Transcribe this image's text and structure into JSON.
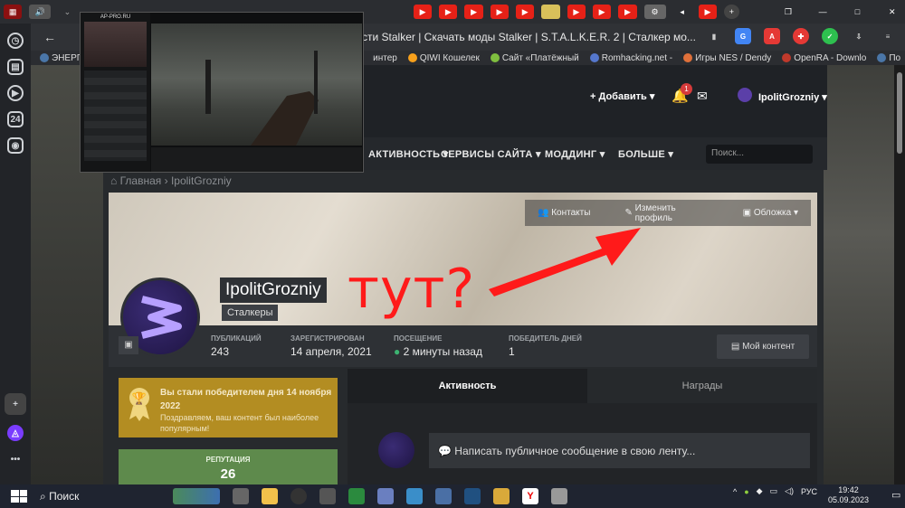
{
  "browser": {
    "url": "сти Stalker | Скачать моды Stalker | S.T.A.L.K.E.R. 2 | Сталкер мо...",
    "bookmarks": [
      "ЭНЕРГ",
      "интер",
      "QIWI Кошелек",
      "Сайт «Платёжный",
      "Romhacking.net -",
      "Игры NES / Dendy",
      "OpenRA - Downlo",
      "По"
    ],
    "tab_count": "1"
  },
  "site": {
    "add_label": "Добавить",
    "notif_count": "1",
    "username": "IpolitGrozniy",
    "nav": [
      "АКТИВНОСТЬ",
      "СЕРВИСЫ САЙТА",
      "МОДДИНГ",
      "БОЛЬШЕ"
    ],
    "search_placeholder": "Поиск...",
    "breadcrumb_home": "Главная",
    "breadcrumb_current": "IpolitGrozniy",
    "cover_buttons": [
      "Контакты",
      "Изменить профиль",
      "Обложка"
    ]
  },
  "profile": {
    "name": "IpolitGrozniy",
    "rank": "Сталкеры",
    "stats": [
      {
        "label": "ПУБЛИКАЦИЙ",
        "value": "243"
      },
      {
        "label": "ЗАРЕГИСТРИРОВАН",
        "value": "14 апреля, 2021"
      },
      {
        "label": "ПОСЕЩЕНИЕ",
        "value": "2 минуты назад"
      },
      {
        "label": "ПОБЕДИТЕЛЬ ДНЕЙ",
        "value": "1"
      }
    ],
    "content_button": "Мой контент",
    "annotation": "тут?"
  },
  "award": {
    "title": "Вы стали победителем дня 14 ноября 2022",
    "desc": "Поздравляем, ваш контент был наиболее популярным!"
  },
  "reputation": {
    "label": "РЕПУТАЦИЯ",
    "value": "26"
  },
  "tabs": [
    "Активность",
    "Награды"
  ],
  "feed": {
    "placeholder": "Написать публичное сообщение в свою ленту..."
  },
  "video": {
    "title": "AP-PRO.RU"
  },
  "taskbar": {
    "search": "Поиск",
    "lang": "РУС",
    "time": "19:42",
    "date": "05.09.2023"
  }
}
